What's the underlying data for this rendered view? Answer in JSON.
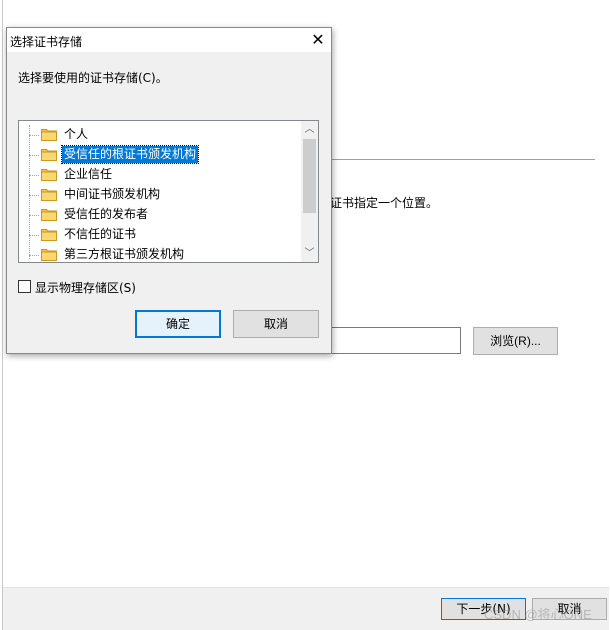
{
  "wizard": {
    "description_fragment": "证书指定一个位置。",
    "browse_label": "浏览(R)...",
    "next_label": "下一步(N)",
    "cancel_label": "取消",
    "watermark": "CSDN @将心ONE"
  },
  "dialog": {
    "title": "选择证书存储",
    "prompt": "选择要使用的证书存储(C)。",
    "tree_items": [
      {
        "label": "个人",
        "selected": false
      },
      {
        "label": "受信任的根证书颁发机构",
        "selected": true
      },
      {
        "label": "企业信任",
        "selected": false
      },
      {
        "label": "中间证书颁发机构",
        "selected": false
      },
      {
        "label": "受信任的发布者",
        "selected": false
      },
      {
        "label": "不信任的证书",
        "selected": false
      },
      {
        "label": "第三方根证书颁发机构",
        "selected": false
      }
    ],
    "show_physical_label": "显示物理存储区(S)",
    "show_physical_checked": false,
    "ok_label": "确定",
    "cancel_label": "取消"
  },
  "icons": {
    "close": "close-icon",
    "folder": "folder-icon",
    "scroll_up": "chevron-up-icon",
    "scroll_down": "chevron-down-icon"
  },
  "colors": {
    "accent": "#0078d7",
    "folder": "#f4c542",
    "dialog_bg": "#f0f0f0"
  }
}
